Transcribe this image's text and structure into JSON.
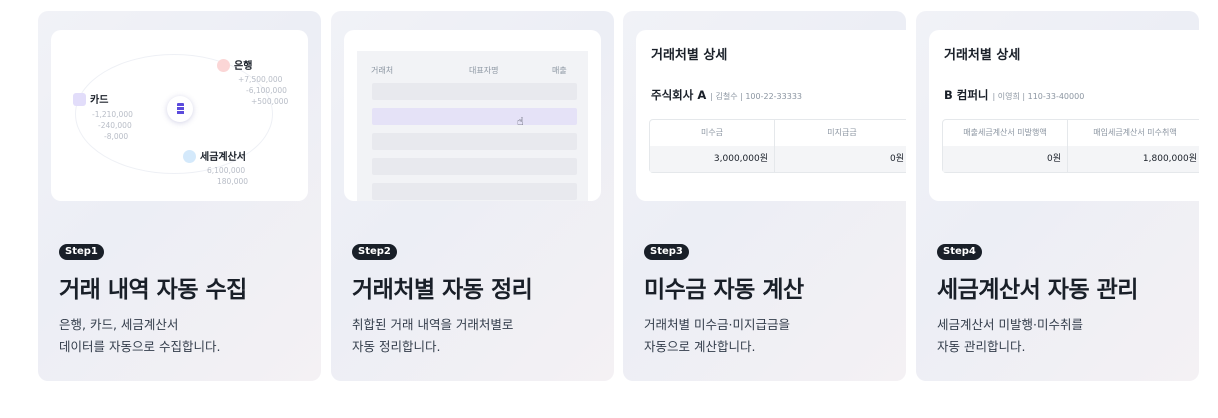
{
  "steps": [
    {
      "badge": "Step1",
      "title": "거래 내역 자동 수집",
      "desc": [
        "은행, 카드, 세금계산서",
        "데이터를 자동으로 수집합니다."
      ]
    },
    {
      "badge": "Step2",
      "title": "거래처별 자동 정리",
      "desc": [
        "취합된 거래 내역을 거래처별로",
        "자동 정리합니다."
      ]
    },
    {
      "badge": "Step3",
      "title": "미수금 자동 계산",
      "desc": [
        "거래처별 미수금·미지급금을",
        "자동으로 계산합니다."
      ]
    },
    {
      "badge": "Step4",
      "title": "세금계산서 자동 관리",
      "desc": [
        "세금계산서 미발행·미수취를",
        "자동 관리합니다."
      ]
    }
  ],
  "collect": {
    "bank": {
      "label": "은행",
      "values": [
        "+7,500,000",
        "-6,100,000",
        "+500,000"
      ]
    },
    "card": {
      "label": "카드",
      "values": [
        "-1,210,000",
        "-240,000",
        "-8,000"
      ]
    },
    "tax": {
      "label": "세금계산서",
      "values": [
        "6,100,000",
        "180,000"
      ]
    }
  },
  "table": {
    "headers": [
      "거래처",
      "대표자명",
      "매출"
    ]
  },
  "detail3": {
    "title": "거래처별 상세",
    "company": "주식회사 A",
    "meta": "| 김철수 | 100-22-33333",
    "headers": [
      "미수금",
      "미지급금"
    ],
    "values": [
      "3,000,000원",
      "0원"
    ]
  },
  "detail4": {
    "title": "거래처별 상세",
    "company": "B 컴퍼니",
    "meta": "| 이영희 | 110-33-40000",
    "headers": [
      "매출세금계산서 미발행액",
      "매입세금계산서 미수취액"
    ],
    "values": [
      "0원",
      "1,800,000원"
    ]
  },
  "colors": {
    "accent": "#5b4bdc",
    "badge": "#191f28"
  }
}
